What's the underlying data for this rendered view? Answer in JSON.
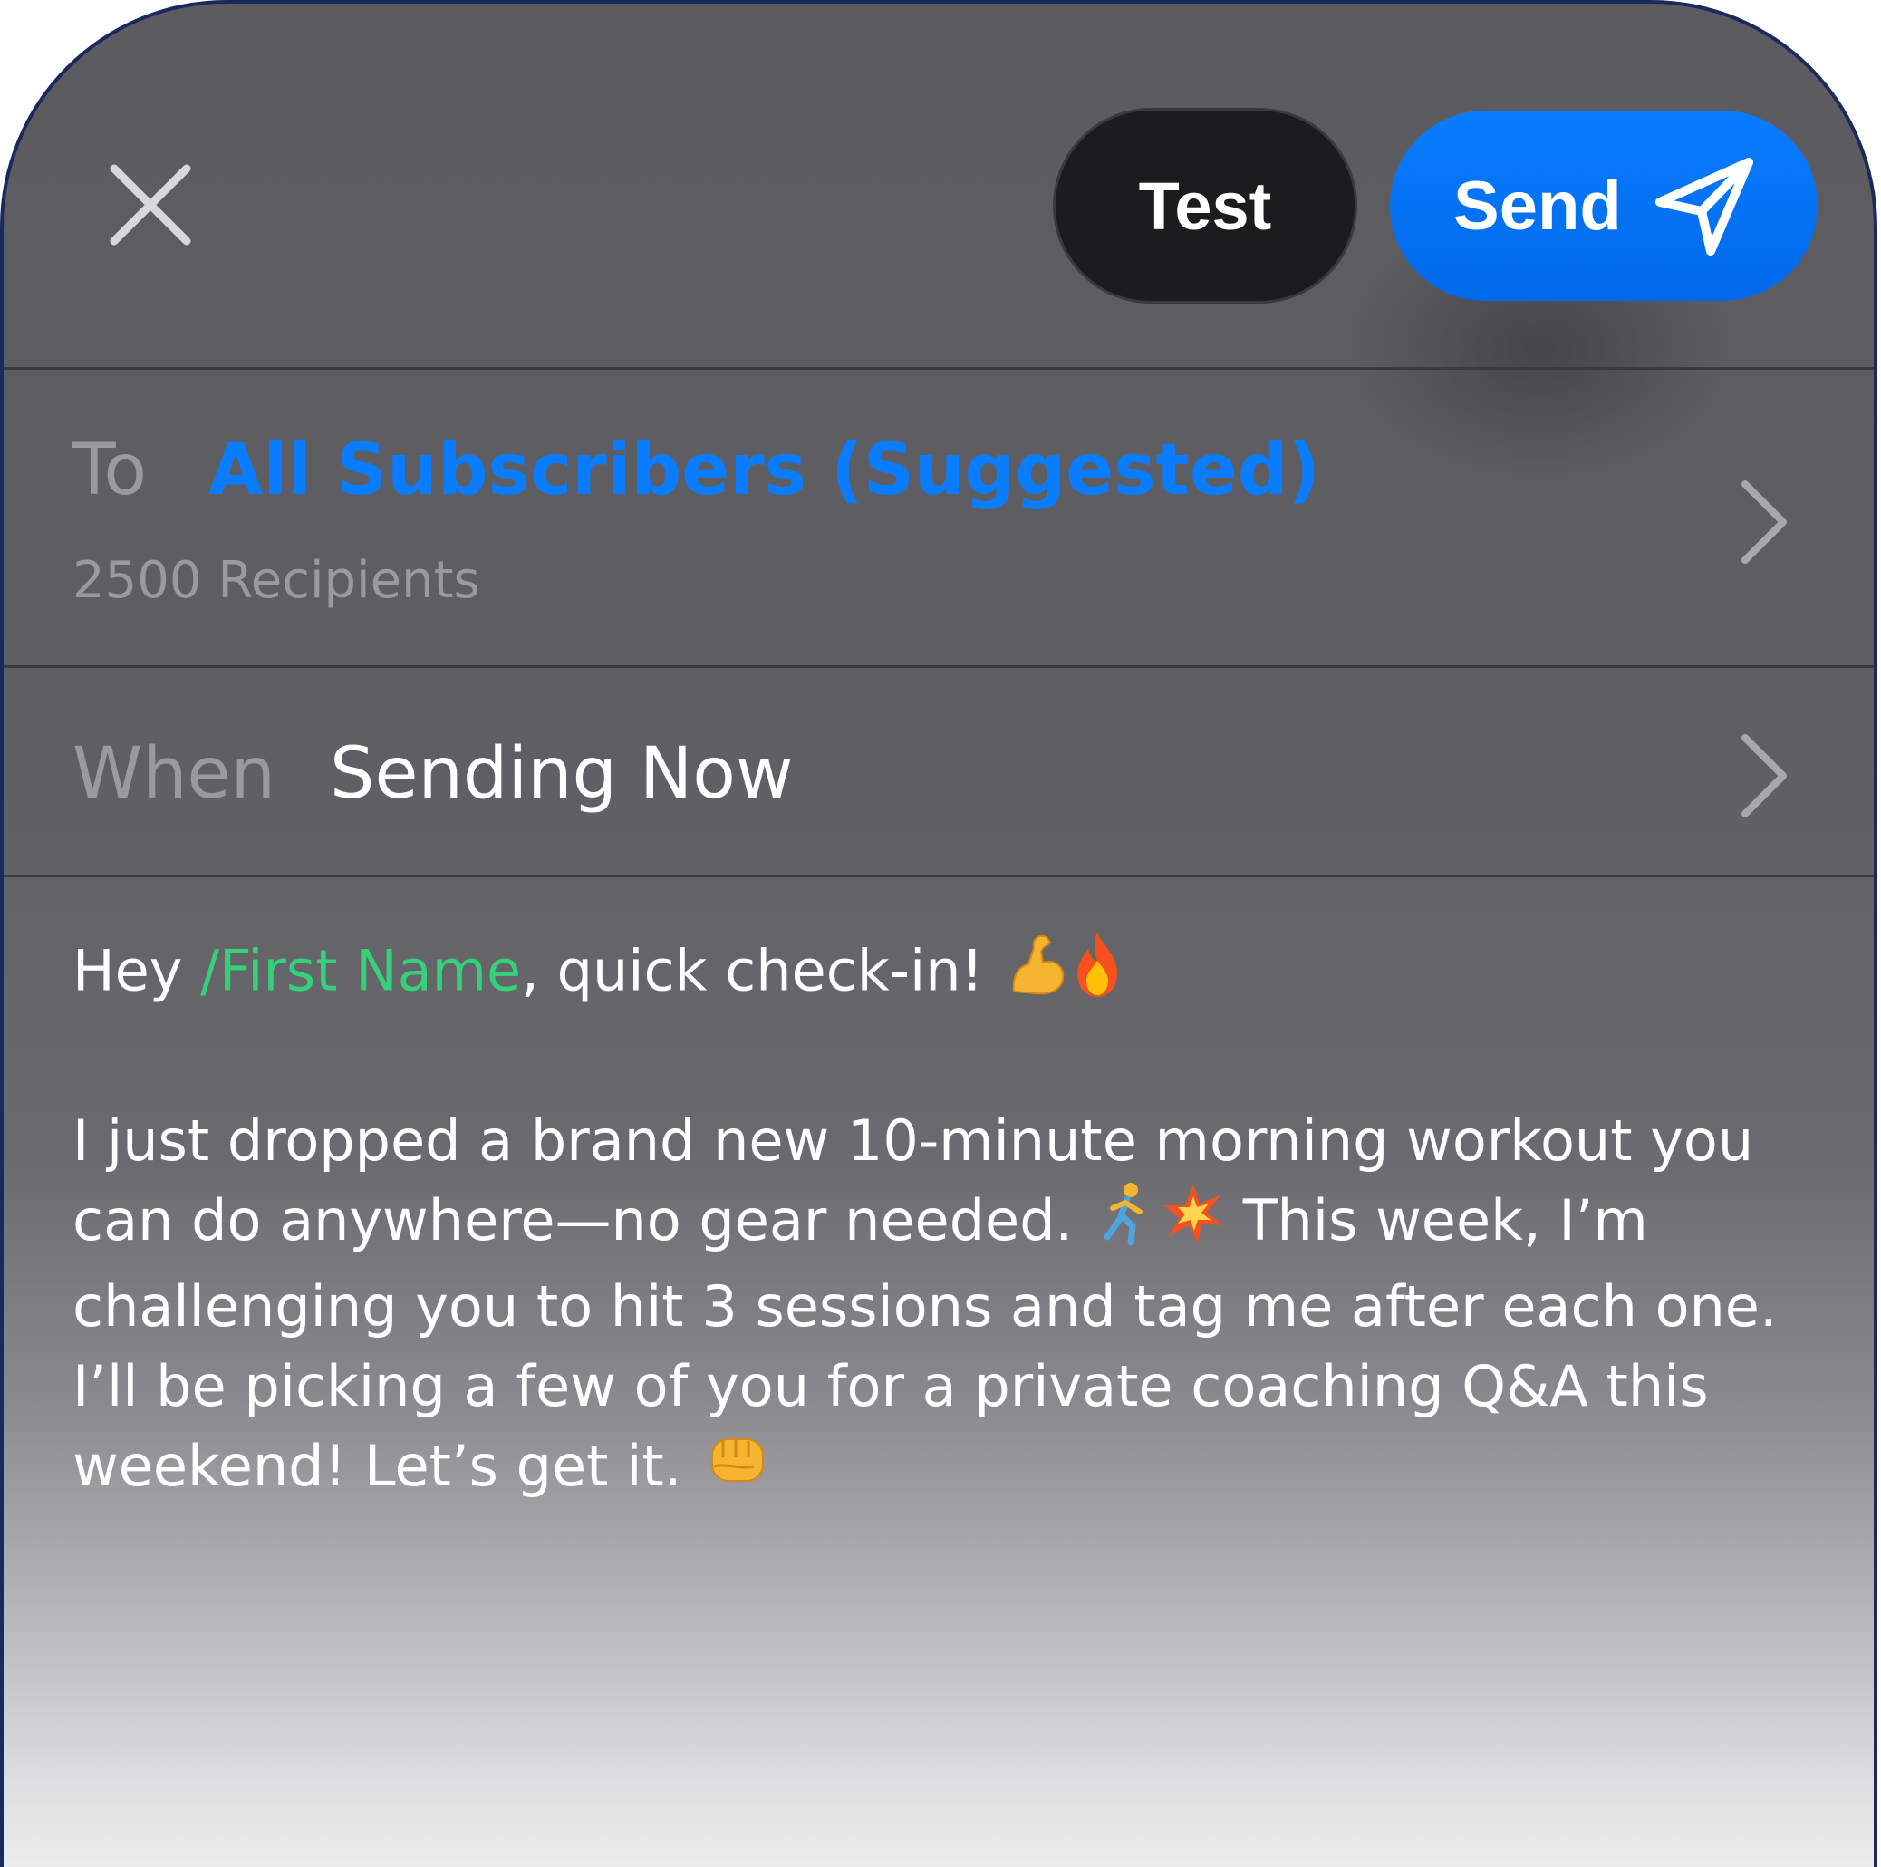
{
  "header": {
    "test_label": "Test",
    "send_label": "Send"
  },
  "recipient": {
    "label": "To",
    "value": "All Subscribers (Suggested)",
    "count_text": "2500 Recipients"
  },
  "schedule": {
    "label": "When",
    "value": "Sending Now"
  },
  "message": {
    "greeting_prefix": "Hey ",
    "variable": "/First Name",
    "greeting_suffix": ", quick check-in! ",
    "line1": "I just dropped a brand new 10-minute morning workout you can do anywhere—no gear needed. ",
    "line2": "This week, I’m challenging you to hit 3 sessions and tag me after each one. I’ll be picking a few of you for a private coaching Q&A this weekend! Let’s get it. "
  },
  "colors": {
    "accent": "#0a7cff",
    "variable": "#34d07a",
    "frame": "#1b2a5e"
  },
  "icons": {
    "close": "close-icon",
    "send": "paper-plane-icon",
    "chevron": "chevron-right-icon"
  }
}
